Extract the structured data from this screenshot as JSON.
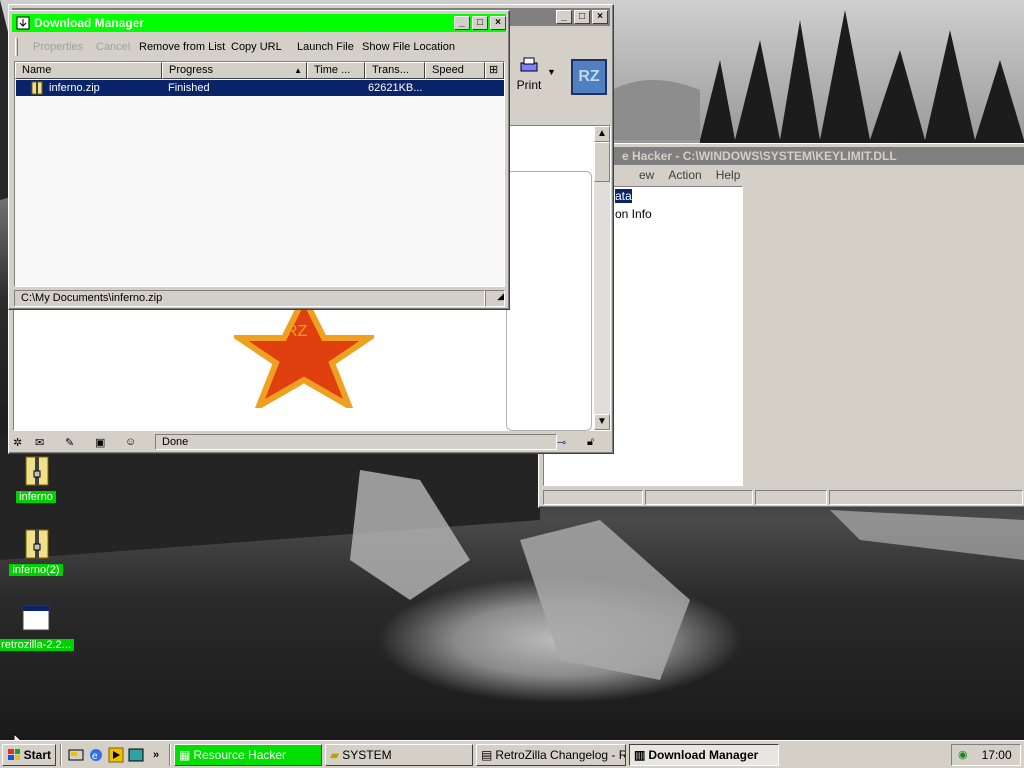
{
  "colors": {
    "accent_active_title": "#00ff00",
    "desktop_label_bg": "#00d000",
    "selection": "#0a246a"
  },
  "desktop": {
    "icons": [
      {
        "label": "inferno",
        "icon": "zip-folder-icon"
      },
      {
        "label": "inferno(2)",
        "icon": "zip-folder-icon"
      },
      {
        "label": "retrozilla-2.2...",
        "icon": "application-window-icon"
      }
    ]
  },
  "browser": {
    "print_label": "Print",
    "logo_text": "RZ",
    "status_text": "Done"
  },
  "reshacker": {
    "title": "e Hacker  -  C:\\WINDOWS\\SYSTEM\\KEYLIMIT.DLL",
    "menu": [
      "ew",
      "Action",
      "Help"
    ],
    "tree": [
      "ata",
      "on Info"
    ]
  },
  "download_manager": {
    "title": "Download Manager",
    "toolbar": {
      "properties": "Properties",
      "cancel": "Cancel",
      "remove": "Remove from List",
      "copy_url": "Copy URL",
      "launch": "Launch File",
      "show_location": "Show File Location"
    },
    "columns": [
      "Name",
      "Progress",
      "Time ...",
      "Trans...",
      "Speed"
    ],
    "rows": [
      {
        "name": "inferno.zip",
        "progress": "Finished",
        "time": "",
        "transferred": "62621KB...",
        "speed": ""
      }
    ],
    "status_path": "C:\\My Documents\\inferno.zip"
  },
  "taskbar": {
    "start_label": "Start",
    "quick_launch": [
      "desktop-icon",
      "ie-icon",
      "media-icon",
      "window-icon"
    ],
    "more": "»",
    "tasks": [
      {
        "label": "Resource Hacker",
        "icon": "reshacker-icon"
      },
      {
        "label": "SYSTEM",
        "icon": "folder-icon"
      },
      {
        "label": "RetroZilla Changelog - R...",
        "icon": "browser-icon"
      },
      {
        "label": "Download Manager",
        "icon": "download-icon"
      }
    ],
    "clock": "17:00"
  }
}
